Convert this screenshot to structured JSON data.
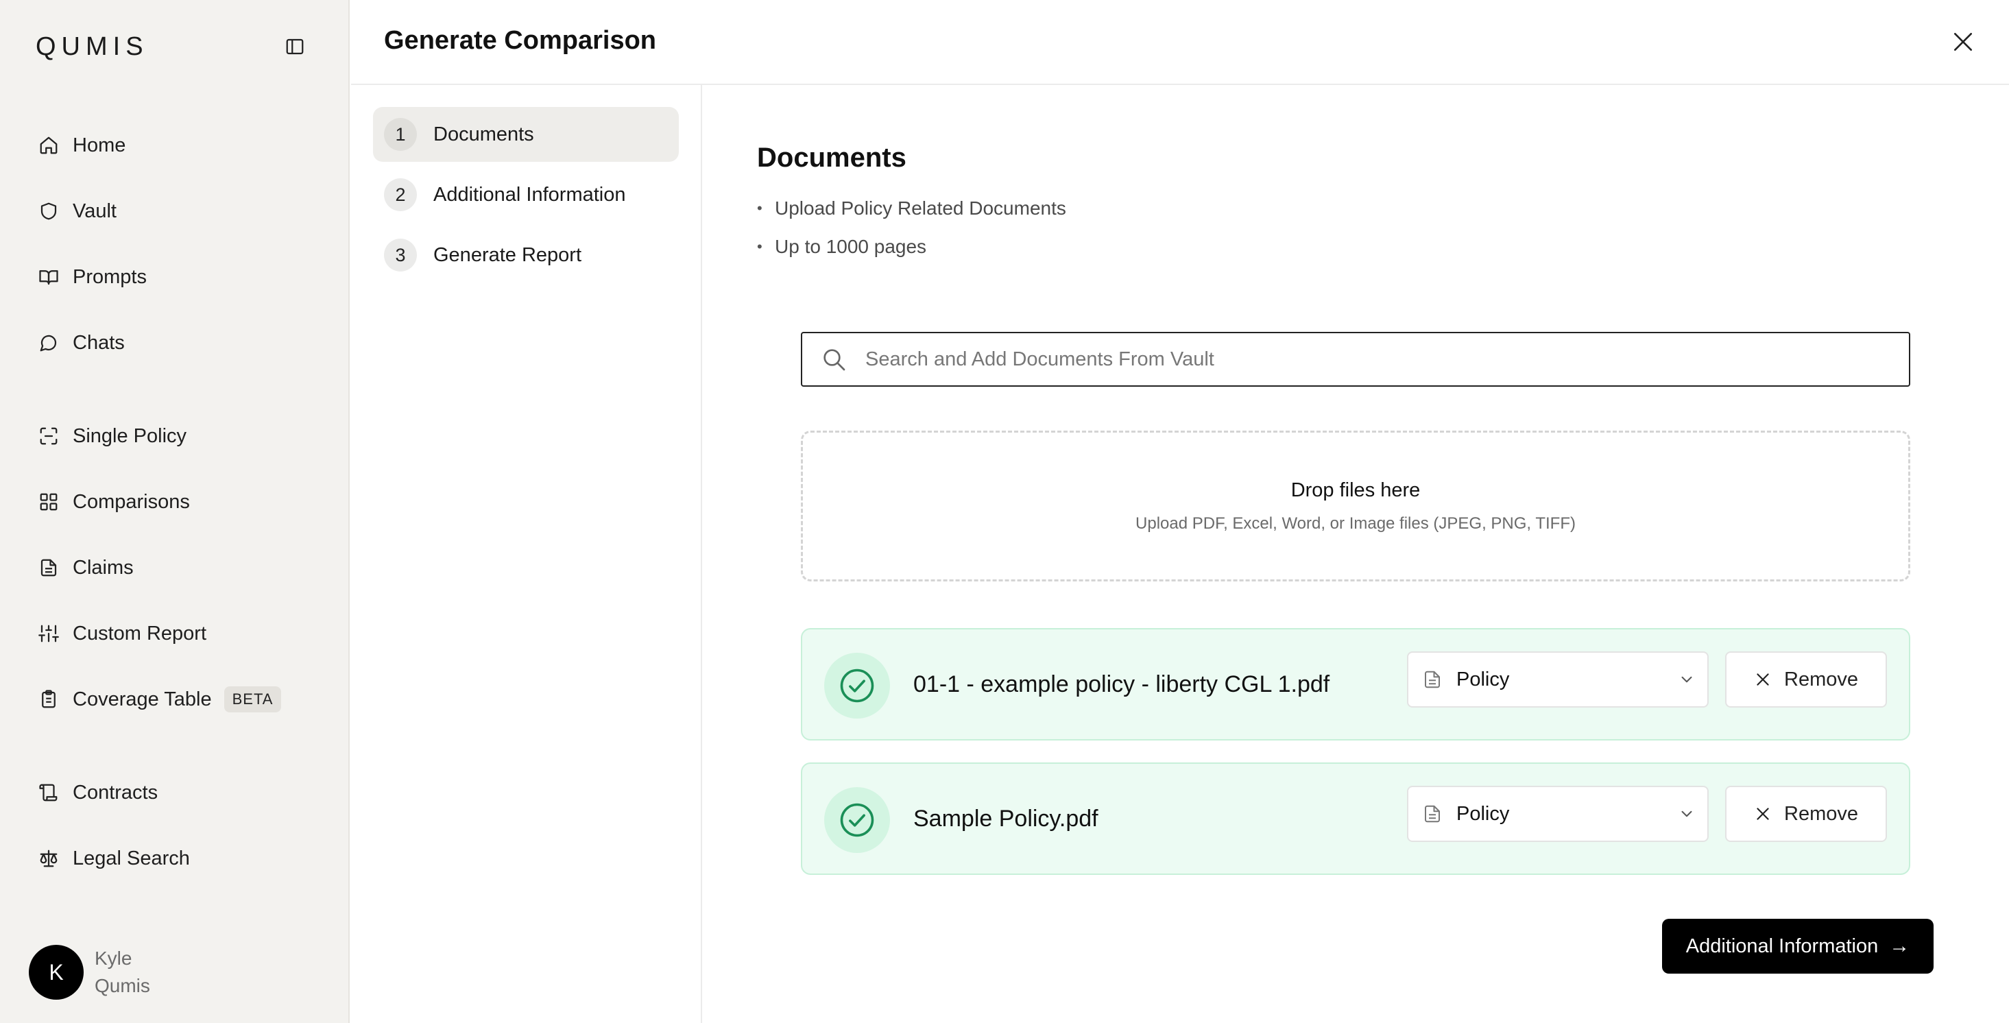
{
  "app": {
    "logo": "QUMIS"
  },
  "sidebar": {
    "items": [
      {
        "label": "Home",
        "icon": "home-icon"
      },
      {
        "label": "Vault",
        "icon": "shield-icon"
      },
      {
        "label": "Prompts",
        "icon": "book-icon"
      },
      {
        "label": "Chats",
        "icon": "chat-icon"
      },
      {
        "label": "Single Policy",
        "icon": "scan-icon"
      },
      {
        "label": "Comparisons",
        "icon": "grid-icon"
      },
      {
        "label": "Claims",
        "icon": "document-icon"
      },
      {
        "label": "Custom Report",
        "icon": "sliders-icon"
      },
      {
        "label": "Coverage Table",
        "icon": "clipboard-icon",
        "badge": "BETA"
      },
      {
        "label": "Contracts",
        "icon": "scroll-icon"
      },
      {
        "label": "Legal Search",
        "icon": "scale-icon"
      }
    ],
    "user": {
      "initial": "K",
      "first_name": "Kyle",
      "last_name": "Qumis"
    }
  },
  "header": {
    "title": "Generate Comparison"
  },
  "steps": [
    {
      "number": "1",
      "label": "Documents",
      "active": true
    },
    {
      "number": "2",
      "label": "Additional Information",
      "active": false
    },
    {
      "number": "3",
      "label": "Generate Report",
      "active": false
    }
  ],
  "main": {
    "title": "Documents",
    "bullets": [
      "Upload Policy Related Documents",
      "Up to 1000 pages"
    ],
    "search": {
      "placeholder": "Search and Add Documents From Vault",
      "value": ""
    },
    "dropzone": {
      "title": "Drop files here",
      "subtitle": "Upload PDF, Excel, Word, or Image files (JPEG, PNG, TIFF)"
    },
    "files": [
      {
        "name": "01-1 - example policy - liberty CGL 1.pdf",
        "type": "Policy",
        "remove_label": "Remove",
        "status": "uploaded"
      },
      {
        "name": "Sample Policy.pdf",
        "type": "Policy",
        "remove_label": "Remove",
        "status": "uploaded"
      }
    ],
    "next_button": {
      "label": "Additional Information",
      "arrow": "→"
    }
  },
  "colors": {
    "sidebar_bg": "#f3f2ef",
    "file_card_bg": "#ecfbf3",
    "file_card_border": "#c7f0d9",
    "check_green": "#1a8f57",
    "primary_button": "#000000"
  }
}
